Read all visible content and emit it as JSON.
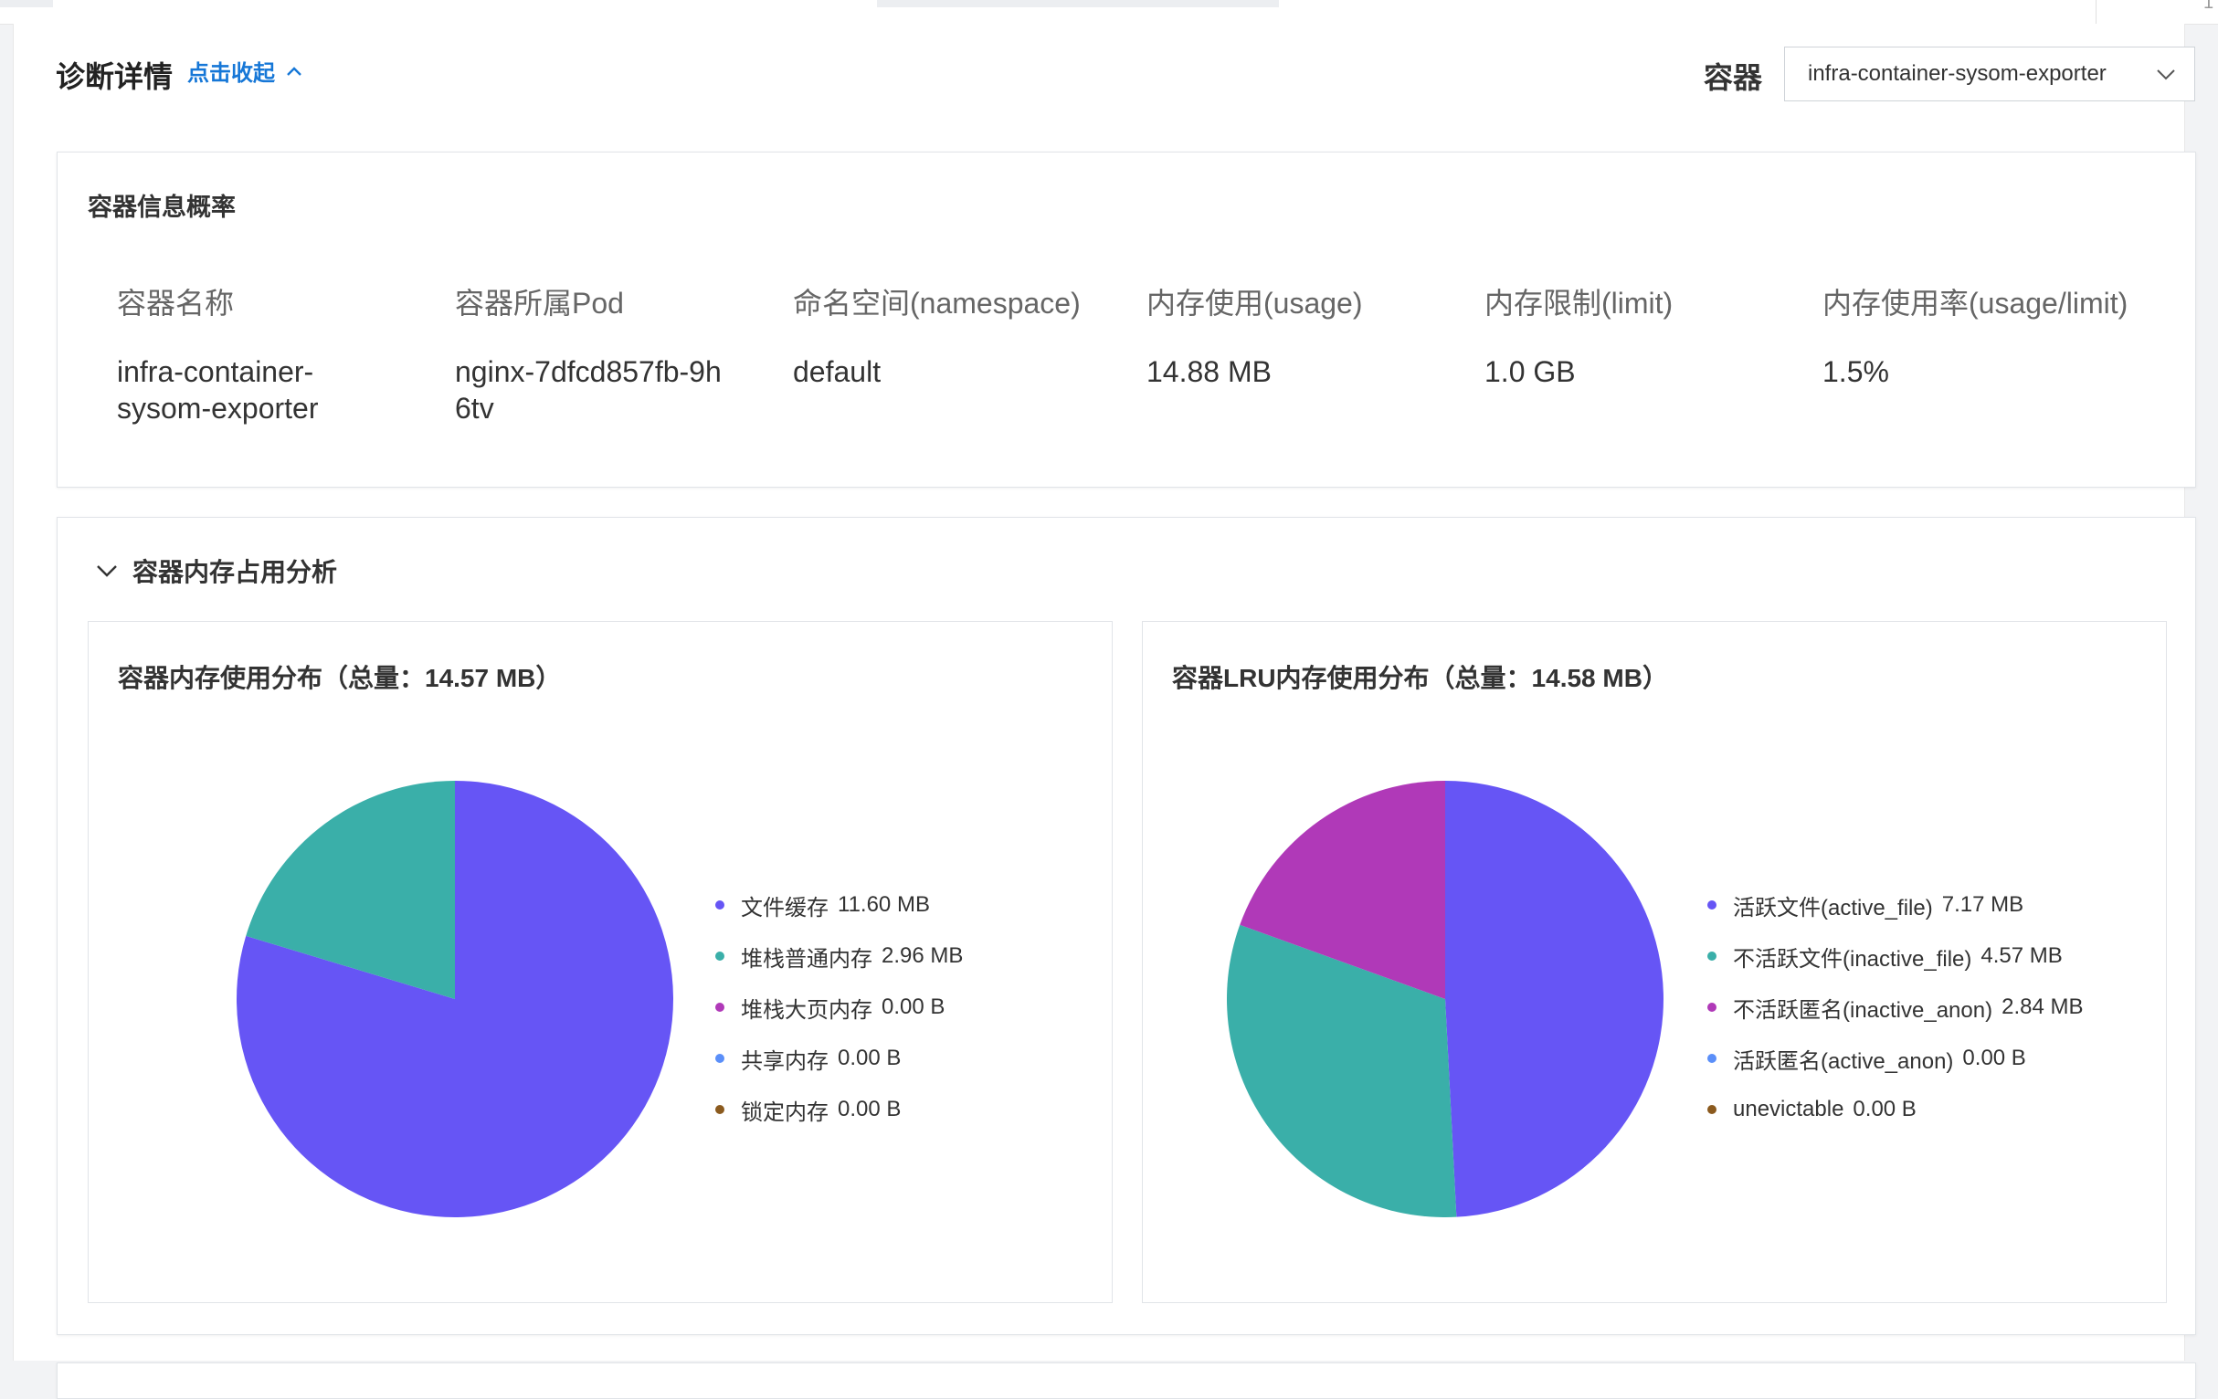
{
  "header": {
    "title": "诊断详情",
    "collapse_link": "点击收起",
    "container_label": "容器",
    "container_value": "infra-container-sysom-exporter",
    "corner_text": "1"
  },
  "info_card": {
    "title": "容器信息概率",
    "columns": [
      {
        "header": "容器名称",
        "value": "infra-container-sysom-exporter"
      },
      {
        "header": "容器所属Pod",
        "value": "nginx-7dfcd857fb-9h6tv"
      },
      {
        "header": "命名空间(namespace)",
        "value": "default"
      },
      {
        "header": "内存使用(usage)",
        "value": "14.88 MB"
      },
      {
        "header": "内存限制(limit)",
        "value": "1.0 GB"
      },
      {
        "header": "内存使用率(usage/limit)",
        "value": "1.5%"
      }
    ]
  },
  "analysis": {
    "title": "容器内存占用分析",
    "charts": [
      {
        "title": "容器内存使用分布（总量：14.57 MB）",
        "legend": [
          {
            "name": "文件缓存",
            "display": "11.60 MB"
          },
          {
            "name": "堆栈普通内存",
            "display": "2.96 MB"
          },
          {
            "name": "堆栈大页内存",
            "display": "0.00 B"
          },
          {
            "name": "共享内存",
            "display": "0.00 B"
          },
          {
            "name": "锁定内存",
            "display": "0.00 B"
          }
        ]
      },
      {
        "title": "容器LRU内存使用分布（总量：14.58 MB）",
        "legend": [
          {
            "name": "活跃文件(active_file)",
            "display": "7.17 MB"
          },
          {
            "name": "不活跃文件(inactive_file)",
            "display": "4.57 MB"
          },
          {
            "name": "不活跃匿名(inactive_anon)",
            "display": "2.84 MB"
          },
          {
            "name": "活跃匿名(active_anon)",
            "display": "0.00 B"
          },
          {
            "name": "unevictable",
            "display": "0.00 B"
          }
        ]
      }
    ]
  },
  "colors": {
    "series": [
      "#6655f5",
      "#3aafa9",
      "#b039b8",
      "#5b8ff9",
      "#8b5a1e"
    ],
    "link": "#1677d7"
  },
  "chart_data": [
    {
      "type": "pie",
      "title": "容器内存使用分布（总量：14.57 MB）",
      "unit": "MB",
      "categories": [
        "文件缓存",
        "堆栈普通内存",
        "堆栈大页内存",
        "共享内存",
        "锁定内存"
      ],
      "values": [
        11.6,
        2.96,
        0,
        0,
        0
      ],
      "legend": "right"
    },
    {
      "type": "pie",
      "title": "容器LRU内存使用分布（总量：14.58 MB）",
      "unit": "MB",
      "categories": [
        "活跃文件(active_file)",
        "不活跃文件(inactive_file)",
        "不活跃匿名(inactive_anon)",
        "活跃匿名(active_anon)",
        "unevictable"
      ],
      "values": [
        7.17,
        4.57,
        2.84,
        0,
        0
      ],
      "legend": "right"
    }
  ]
}
